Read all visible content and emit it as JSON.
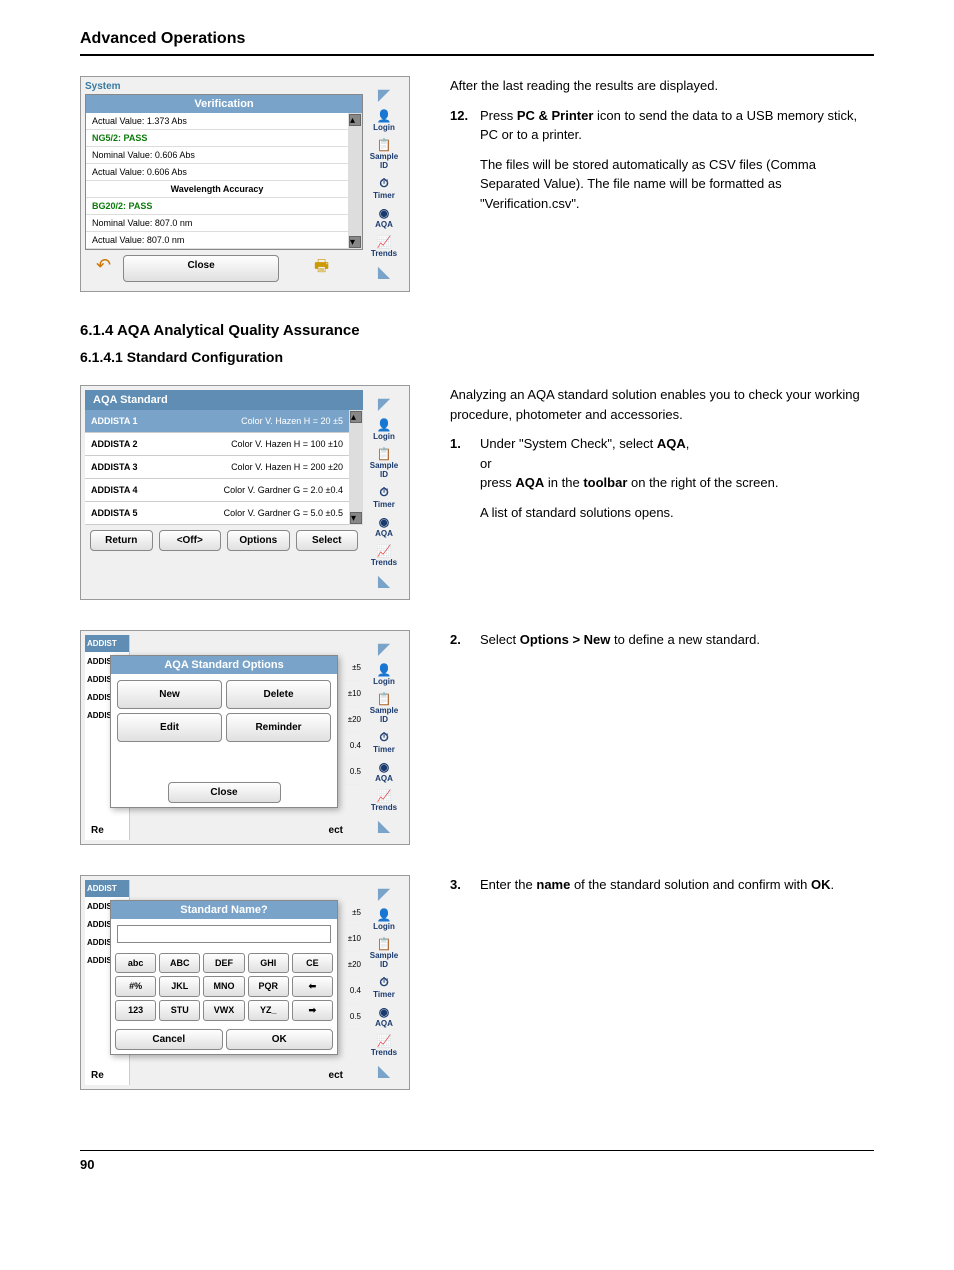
{
  "header": "Advanced Operations",
  "pageNum": "90",
  "screenshot1": {
    "sys": "System",
    "title": "Verification",
    "lines": [
      {
        "text": "Actual Value:  1.373 Abs",
        "cls": ""
      },
      {
        "text": "NG5/2: PASS",
        "cls": "green"
      },
      {
        "text": "Nominal Value:  0.606 Abs",
        "cls": ""
      },
      {
        "text": "Actual Value:  0.606 Abs",
        "cls": ""
      },
      {
        "text": "Wavelength Accuracy",
        "cls": "b center"
      },
      {
        "text": "BG20/2: PASS",
        "cls": "green"
      },
      {
        "text": "Nominal Value:  807.0 nm",
        "cls": ""
      },
      {
        "text": "Actual Value:  807.0 nm",
        "cls": ""
      }
    ],
    "close": "Close",
    "tools": [
      "Login",
      "Sample ID",
      "Timer",
      "AQA",
      "Trends"
    ]
  },
  "text1": {
    "p1": "After the last reading the results are displayed.",
    "n": "12.",
    "step": "Press PC & Printer icon to send the data to a USB memory stick, PC or to a printer.",
    "step_parts": [
      "Press ",
      "PC & Printer",
      " icon to send the data to a USB memory stick, PC or to a printer."
    ],
    "p2": "The files will be stored automatically as CSV files (Comma Separated Value). The file name will be formatted as \"Verification.csv\"."
  },
  "section": "6.1.4     AQA Analytical Quality Assurance",
  "subsection": "6.1.4.1     Standard Configuration",
  "screenshot2": {
    "header": "AQA Standard",
    "rows": [
      {
        "name": "ADDISTA 1",
        "val": "Color V. Hazen  H   = 20  ±5",
        "sel": true
      },
      {
        "name": "ADDISTA 2",
        "val": "Color V. Hazen  H   = 100  ±10",
        "sel": false
      },
      {
        "name": "ADDISTA 3",
        "val": "Color V. Hazen  H   = 200  ±20",
        "sel": false
      },
      {
        "name": "ADDISTA 4",
        "val": "Color V. Gardner  G   = 2.0  ±0.4",
        "sel": false
      },
      {
        "name": "ADDISTA 5",
        "val": "Color V. Gardner  G   = 5.0  ±0.5",
        "sel": false
      }
    ],
    "buttons": [
      "Return",
      "<Off>",
      "Options",
      "Select"
    ],
    "tools": [
      "Login",
      "Sample ID",
      "Timer",
      "AQA",
      "Trends"
    ]
  },
  "text2": {
    "p1": "Analyzing an AQA standard solution enables you to check your working procedure, photometer and accessories.",
    "n": "1.",
    "step_parts_a": [
      "Under \"System Check\", select ",
      "AQA",
      ","
    ],
    "or": "or",
    "step_parts_b": [
      "press ",
      "AQA",
      "  in the ",
      "toolbar",
      " on the right of the screen."
    ],
    "p2": "A list of standard solutions opens."
  },
  "screenshot3": {
    "title": "AQA Standard Options",
    "buttons": [
      "New",
      "Delete",
      "Edit",
      "Reminder"
    ],
    "close": "Close",
    "ghost": [
      "ADDIST",
      "ADDIST",
      "ADDIST",
      "ADDIST",
      "ADDIST"
    ],
    "ghostR": [
      "±5",
      "±10",
      "±20",
      "0.4",
      "0.5"
    ],
    "re": "Re",
    "ect": "ect",
    "aqa": "AQA",
    "tools": [
      "Login",
      "Sample ID",
      "Timer",
      "AQA",
      "Trends"
    ]
  },
  "text3": {
    "n": "2.",
    "parts": [
      "Select ",
      "Options > New",
      " to define a new standard."
    ]
  },
  "screenshot4": {
    "title": "Standard Name?",
    "keys": [
      [
        "abc",
        "ABC",
        "DEF",
        "GHI",
        "CE"
      ],
      [
        "#%",
        "JKL",
        "MNO",
        "PQR",
        "⬅"
      ],
      [
        "123",
        "STU",
        "VWX",
        "YZ_",
        "➡"
      ]
    ],
    "cancel": "Cancel",
    "ok": "OK",
    "ghost": [
      "ADDIST",
      "ADDIST",
      "ADDIST",
      "ADDIST",
      "ADDIST"
    ],
    "ghostR": [
      "±5",
      "±10",
      "±20",
      "0.4",
      "0.5"
    ],
    "re": "Re",
    "ect": "ect",
    "aqa": "AQA",
    "tools": [
      "Login",
      "Sample ID",
      "Timer",
      "AQA",
      "Trends"
    ]
  },
  "text4": {
    "n": "3.",
    "parts": [
      "Enter the ",
      "name",
      " of the standard solution and confirm with ",
      "OK",
      "."
    ]
  }
}
